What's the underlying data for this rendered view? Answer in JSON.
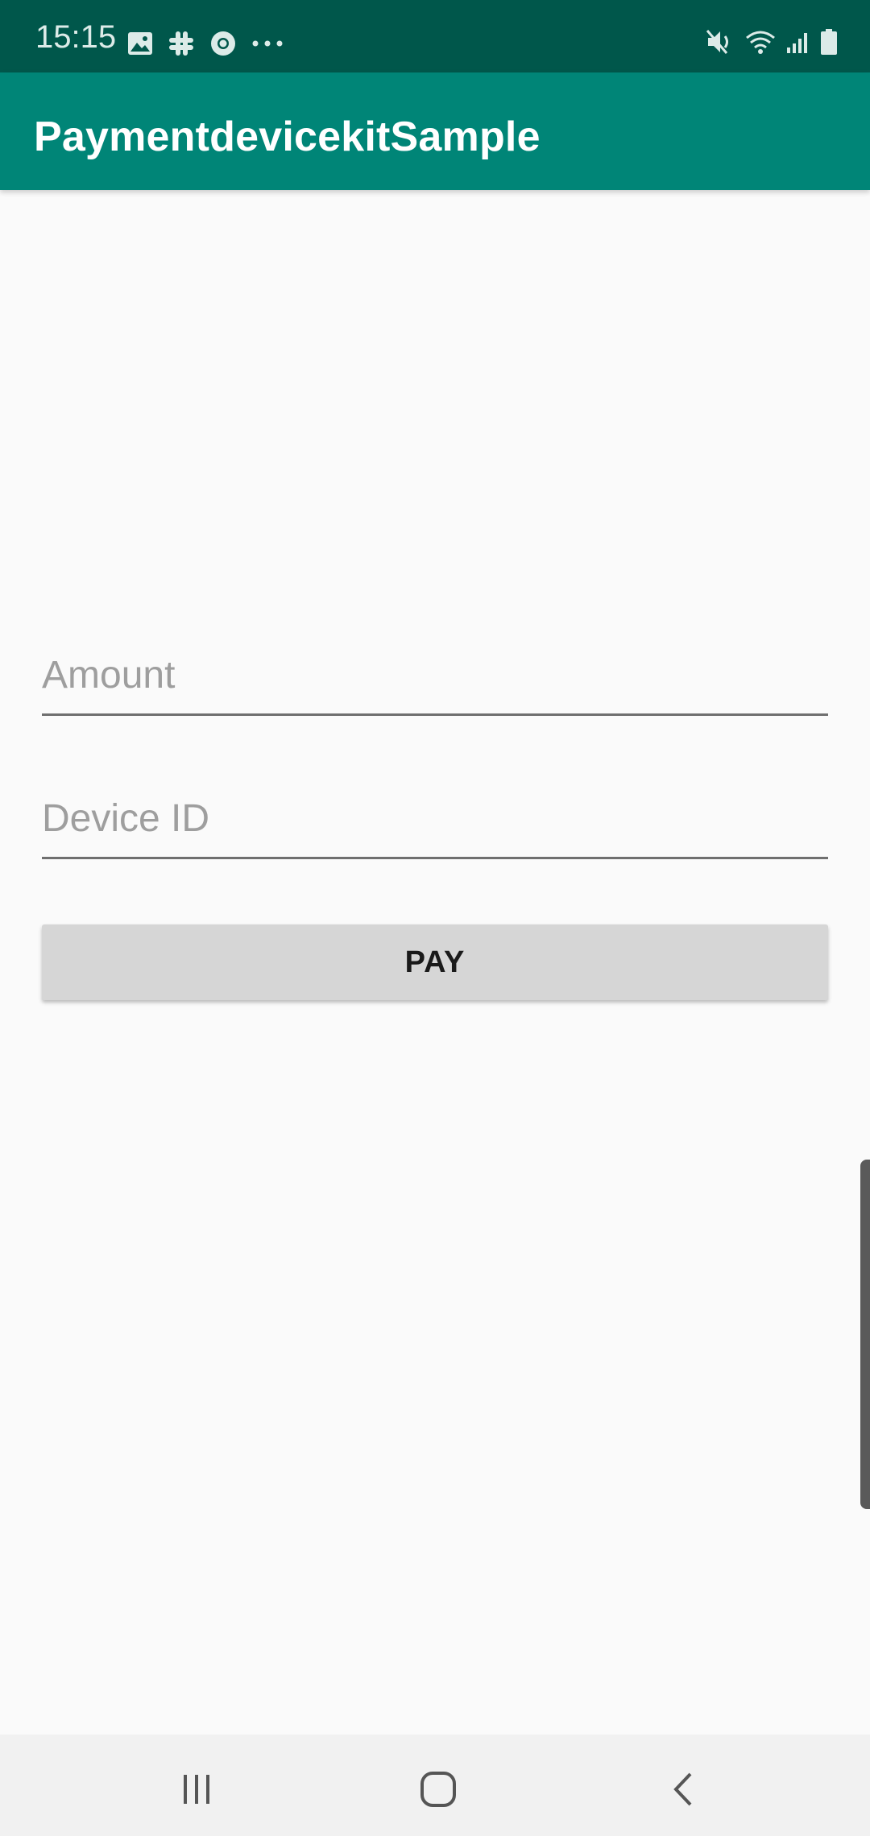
{
  "status_bar": {
    "time": "15:15",
    "left_icons": [
      "gallery-icon",
      "slack-icon",
      "chrome-icon",
      "more-dots-icon"
    ],
    "right_icons": [
      "mute-icon",
      "wifi-icon",
      "signal-icon",
      "battery-icon"
    ]
  },
  "app_bar": {
    "title": "PaymentdevicekitSample",
    "color": "#008577"
  },
  "form": {
    "amount_placeholder": "Amount",
    "device_id_placeholder": "Device ID",
    "pay_label": "PAY"
  },
  "nav_bar": {
    "buttons": [
      "recents-icon",
      "home-icon",
      "back-icon"
    ]
  },
  "colors": {
    "status_bar": "#00574b",
    "app_bar": "#008577",
    "background": "#fafafa",
    "button": "#d6d6d6"
  }
}
